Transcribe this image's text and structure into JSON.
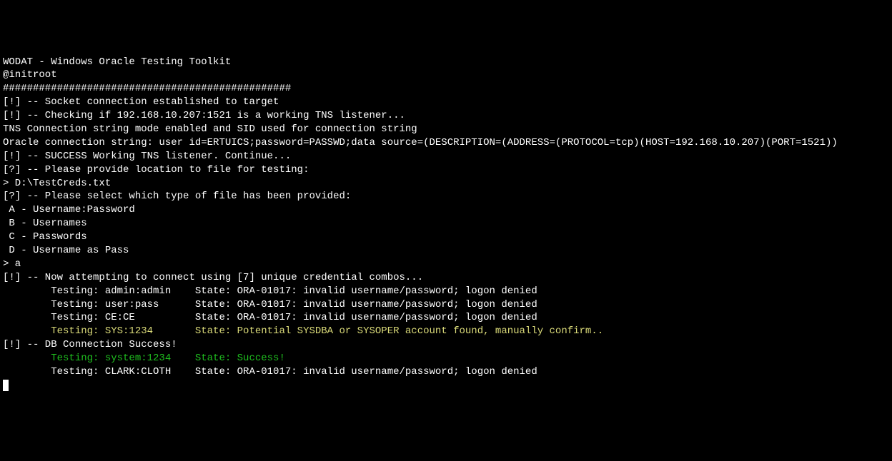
{
  "lines": {
    "l00": "WODAT - Windows Oracle Testing Toolkit",
    "l01": "@initroot",
    "l02": "################################################",
    "l03": "[!] -- Socket connection established to target",
    "l04": "[!] -- Checking if 192.168.10.207:1521 is a working TNS listener...",
    "l05": "TNS Connection string mode enabled and SID used for connection string",
    "l06": "Oracle connection string: user id=ERTUICS;password=PASSWD;data source=(DESCRIPTION=(ADDRESS=(PROTOCOL=tcp)(HOST=192.168.10.207)(PORT=1521))",
    "l07": "[!] -- SUCCESS Working TNS listener. Continue...",
    "l08": "[?] -- Please provide location to file for testing:",
    "l09": "> D:\\TestCreds.txt",
    "l10": "[?] -- Please select which type of file has been provided:",
    "l11": " A - Username:Password",
    "l12": " B - Usernames",
    "l13": " C - Passwords",
    "l14": " D - Username as Pass",
    "l15": "> a",
    "l16": "[!] -- Now attempting to connect using [7] unique credential combos...",
    "l17": "        Testing: admin:admin    State: ORA-01017: invalid username/password; logon denied",
    "l18": "        Testing: user:pass      State: ORA-01017: invalid username/password; logon denied",
    "l19": "        Testing: CE:CE          State: ORA-01017: invalid username/password; logon denied",
    "l20": "        Testing: SYS:1234       State: Potential SYSDBA or SYSOPER account found, manually confirm..",
    "l21": "[!] -- DB Connection Success!",
    "l22": "        Testing: system:1234    State: Success!",
    "l23": "        Testing: CLARK:CLOTH    State: ORA-01017: invalid username/password; logon denied"
  }
}
